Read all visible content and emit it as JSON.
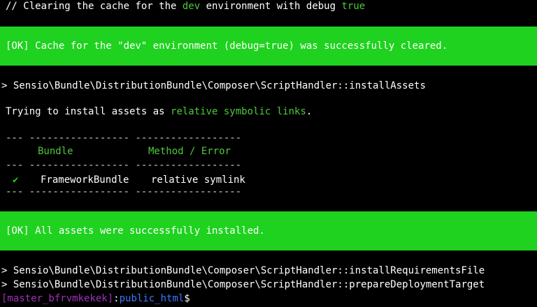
{
  "comment_line": {
    "prefix": "// Clearing the cache for the ",
    "env": "dev",
    "middle": " environment with debug ",
    "debug": "true"
  },
  "cache_box": {
    "message": "[OK] Cache for the \"dev\" environment (debug=true) was successfully cleared."
  },
  "install_assets_cmd": "> Sensio\\Bundle\\DistributionBundle\\Composer\\ScriptHandler::installAssets",
  "trying_line": {
    "prefix": "Trying to install assets as ",
    "mode": "relative symbolic links",
    "suffix": "."
  },
  "table": {
    "rule": "--- ----------------- ------------------",
    "headers": {
      "bundle": "Bundle",
      "method": "Method / Error"
    },
    "rows": [
      {
        "status_icon": "✔",
        "bundle": "FrameworkBundle",
        "method": "relative symlink"
      }
    ]
  },
  "assets_box": {
    "message": "[OK] All assets were successfully installed."
  },
  "requirements_cmd": "> Sensio\\Bundle\\DistributionBundle\\Composer\\ScriptHandler::installRequirementsFile",
  "deploy_cmd": "> Sensio\\Bundle\\DistributionBundle\\Composer\\ScriptHandler::prepareDeploymentTarget",
  "prompt": {
    "user": "[master_bfrvmkekek]",
    "sep": ":",
    "dir": "public_html",
    "symbol": "$"
  },
  "colors": {
    "success_bg": "#1fd21f",
    "accent_green": "#4ec83c",
    "prompt_user": "#a030b8",
    "prompt_dir": "#3a78ff"
  }
}
